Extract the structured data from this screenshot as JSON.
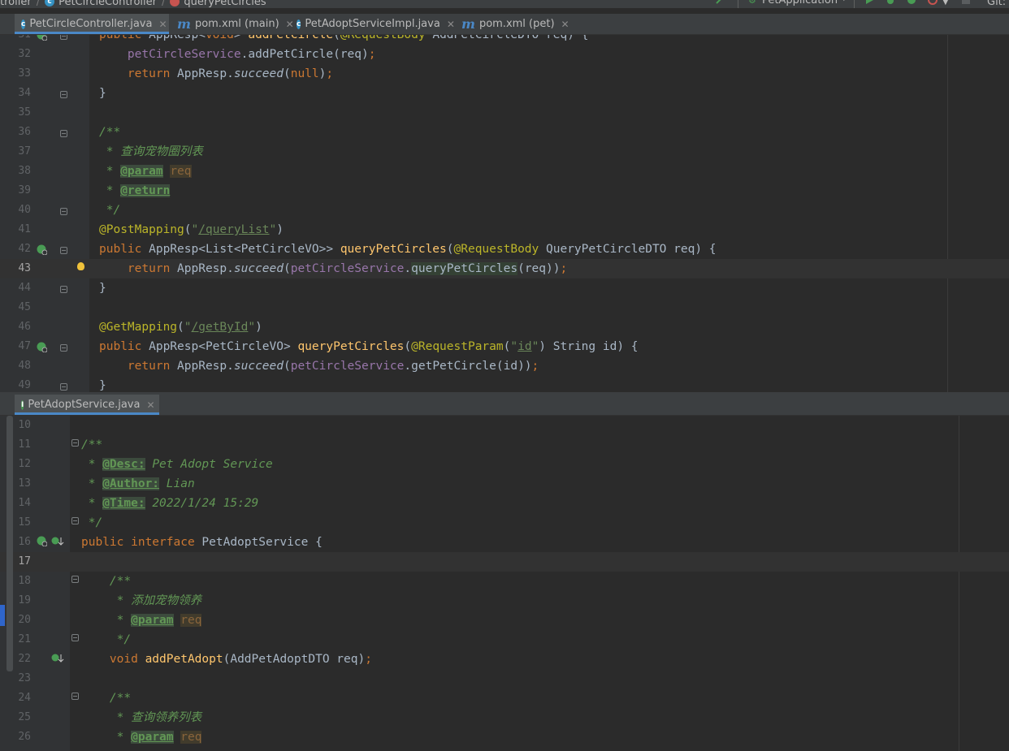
{
  "navbar": {
    "crumbs": [
      "troller",
      "PetCircleController",
      "queryPetCircles"
    ],
    "run_config": "PetApplication",
    "vcs": "Git:"
  },
  "top_tabs": [
    {
      "label": "PetCircleController.java",
      "icon": "class-icon"
    },
    {
      "label": "pom.xml (main)",
      "icon": "maven-icon"
    },
    {
      "label": "PetAdoptServiceImpl.java",
      "icon": "class-icon"
    },
    {
      "label": "pom.xml (pet)",
      "icon": "maven-icon"
    }
  ],
  "bottom_tabs": [
    {
      "label": "PetAdoptService.java",
      "icon": "interface-icon"
    }
  ],
  "editor1": {
    "lines": [
      {
        "n": "31",
        "t": [
          [
            "kw",
            "public "
          ],
          [
            "",
            "AppResp<"
          ],
          [
            "kw",
            "void"
          ],
          [
            "",
            "> "
          ],
          [
            "fn",
            "addPetCircle"
          ],
          [
            "",
            "("
          ],
          [
            "an",
            "@RequestBody "
          ],
          [
            "",
            "AddPetCircleDTO req) {"
          ]
        ]
      },
      {
        "n": "32",
        "t": [
          [
            "",
            "    "
          ],
          [
            "fld",
            "petCircleService"
          ],
          [
            "",
            ".addPetCircle(req)"
          ],
          [
            "kw",
            ";"
          ]
        ]
      },
      {
        "n": "33",
        "t": [
          [
            "",
            "    "
          ],
          [
            "kw",
            "return "
          ],
          [
            "",
            "AppResp."
          ],
          [
            "it",
            "succeed"
          ],
          [
            "",
            "("
          ],
          [
            "kw",
            "null"
          ],
          [
            "",
            ")"
          ],
          [
            "kw",
            ";"
          ]
        ]
      },
      {
        "n": "34",
        "t": [
          [
            "",
            "}"
          ]
        ]
      },
      {
        "n": "35",
        "t": []
      },
      {
        "n": "36",
        "t": [
          [
            "cm",
            "/**"
          ]
        ]
      },
      {
        "n": "37",
        "t": [
          [
            "cm",
            " * 查询宠物圈列表"
          ]
        ]
      },
      {
        "n": "38",
        "t": [
          [
            "cm",
            " * "
          ],
          [
            "tag",
            "@param"
          ],
          [
            "cm",
            " "
          ],
          [
            "prm",
            "req"
          ]
        ]
      },
      {
        "n": "39",
        "t": [
          [
            "cm",
            " * "
          ],
          [
            "tag",
            "@return"
          ]
        ]
      },
      {
        "n": "40",
        "t": [
          [
            "cm",
            " */"
          ]
        ]
      },
      {
        "n": "41",
        "t": [
          [
            "an",
            "@PostMapping"
          ],
          [
            "",
            "("
          ],
          [
            "str",
            "\""
          ],
          [
            "strl",
            "/queryList"
          ],
          [
            "str",
            "\""
          ],
          [
            "",
            ")"
          ]
        ]
      },
      {
        "n": "42",
        "t": [
          [
            "kw",
            "public "
          ],
          [
            "",
            "AppResp<List<PetCircleVO>> "
          ],
          [
            "fn",
            "queryPetCircles"
          ],
          [
            "",
            "("
          ],
          [
            "an",
            "@RequestBody "
          ],
          [
            "",
            "QueryPetCircleDTO req) {"
          ]
        ]
      },
      {
        "n": "43",
        "t": [
          [
            "",
            "    "
          ],
          [
            "kw",
            "return "
          ],
          [
            "",
            "AppResp."
          ],
          [
            "it",
            "succeed"
          ],
          [
            "",
            "("
          ],
          [
            "fld",
            "petCircleService"
          ],
          [
            "",
            "."
          ],
          [
            "hl",
            "queryPetCircles"
          ],
          [
            "",
            "(req))"
          ],
          [
            "kw",
            ";"
          ]
        ]
      },
      {
        "n": "44",
        "t": [
          [
            "",
            "}"
          ]
        ]
      },
      {
        "n": "45",
        "t": []
      },
      {
        "n": "46",
        "t": [
          [
            "an",
            "@GetMapping"
          ],
          [
            "",
            "("
          ],
          [
            "str",
            "\""
          ],
          [
            "strl",
            "/getById"
          ],
          [
            "str",
            "\""
          ],
          [
            "",
            ")"
          ]
        ]
      },
      {
        "n": "47",
        "t": [
          [
            "kw",
            "public "
          ],
          [
            "",
            "AppResp<PetCircleVO> "
          ],
          [
            "fn",
            "queryPetCircles"
          ],
          [
            "",
            "("
          ],
          [
            "an",
            "@RequestParam"
          ],
          [
            "",
            "("
          ],
          [
            "str",
            "\""
          ],
          [
            "strl",
            "id"
          ],
          [
            "str",
            "\""
          ],
          [
            "",
            ") String id) {"
          ]
        ]
      },
      {
        "n": "48",
        "t": [
          [
            "",
            "    "
          ],
          [
            "kw",
            "return "
          ],
          [
            "",
            "AppResp."
          ],
          [
            "it",
            "succeed"
          ],
          [
            "",
            "("
          ],
          [
            "fld",
            "petCircleService"
          ],
          [
            "",
            ".getPetCircle(id))"
          ],
          [
            "kw",
            ";"
          ]
        ]
      },
      {
        "n": "49",
        "t": [
          [
            "",
            "}"
          ]
        ]
      }
    ]
  },
  "editor2": {
    "lines": [
      {
        "n": "10",
        "t": []
      },
      {
        "n": "11",
        "t": [
          [
            "cm",
            "/**"
          ]
        ]
      },
      {
        "n": "12",
        "t": [
          [
            "cm",
            " * "
          ],
          [
            "tag",
            "@Desc:"
          ],
          [
            "cm",
            " Pet Adopt Service"
          ]
        ]
      },
      {
        "n": "13",
        "t": [
          [
            "cm",
            " * "
          ],
          [
            "tag",
            "@Author:"
          ],
          [
            "cm",
            " Lian"
          ]
        ]
      },
      {
        "n": "14",
        "t": [
          [
            "cm",
            " * "
          ],
          [
            "tag",
            "@Time:"
          ],
          [
            "cm",
            " 2022/1/24 15:29"
          ]
        ]
      },
      {
        "n": "15",
        "t": [
          [
            "cm",
            " */"
          ]
        ]
      },
      {
        "n": "16",
        "t": [
          [
            "kw",
            "public interface "
          ],
          [
            "",
            "PetAdoptService {"
          ]
        ]
      },
      {
        "n": "17",
        "t": []
      },
      {
        "n": "18",
        "t": [
          [
            "",
            "    "
          ],
          [
            "cm",
            "/**"
          ]
        ]
      },
      {
        "n": "19",
        "t": [
          [
            "",
            "    "
          ],
          [
            "cm",
            " * 添加宠物领养"
          ]
        ]
      },
      {
        "n": "20",
        "t": [
          [
            "",
            "    "
          ],
          [
            "cm",
            " * "
          ],
          [
            "tag",
            "@param"
          ],
          [
            "cm",
            " "
          ],
          [
            "prm",
            "req"
          ]
        ]
      },
      {
        "n": "21",
        "t": [
          [
            "",
            "    "
          ],
          [
            "cm",
            " */"
          ]
        ]
      },
      {
        "n": "22",
        "t": [
          [
            "",
            "    "
          ],
          [
            "kw",
            "void "
          ],
          [
            "fn",
            "addPetAdopt"
          ],
          [
            "",
            "(AddPetAdoptDTO req)"
          ],
          [
            "kw",
            ";"
          ]
        ]
      },
      {
        "n": "23",
        "t": []
      },
      {
        "n": "24",
        "t": [
          [
            "",
            "    "
          ],
          [
            "cm",
            "/**"
          ]
        ]
      },
      {
        "n": "25",
        "t": [
          [
            "",
            "    "
          ],
          [
            "cm",
            " * 查询领养列表"
          ]
        ]
      },
      {
        "n": "26",
        "t": [
          [
            "",
            "    "
          ],
          [
            "cm",
            " * "
          ],
          [
            "tag",
            "@param"
          ],
          [
            "cm",
            " "
          ],
          [
            "prm",
            "req"
          ]
        ]
      }
    ]
  }
}
